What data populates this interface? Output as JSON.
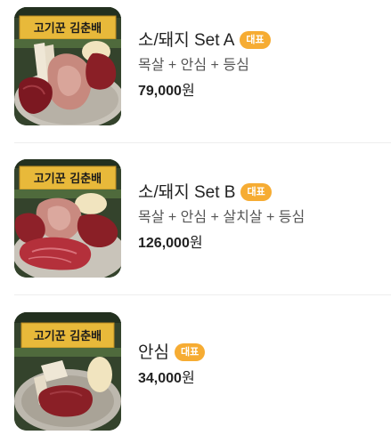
{
  "colors": {
    "badge_bg": "#f6ac33",
    "badge_text": "#ffffff",
    "name_text": "#222222",
    "desc_text": "#555555",
    "divider": "#eeeeee"
  },
  "menu": {
    "items": [
      {
        "name": "소/돼지 Set A",
        "badge": "대표",
        "description": "목살 + 안심 + 등심",
        "price": "79,000",
        "currency": "원",
        "image_sign_text": "고기꾼 김춘배"
      },
      {
        "name": "소/돼지 Set B",
        "badge": "대표",
        "description": "목살 + 안심 + 살치살 + 등심",
        "price": "126,000",
        "currency": "원",
        "image_sign_text": "고기꾼 김춘배"
      },
      {
        "name": "안심",
        "badge": "대표",
        "price": "34,000",
        "currency": "원",
        "image_sign_text": "고기꾼 김춘배"
      }
    ]
  }
}
